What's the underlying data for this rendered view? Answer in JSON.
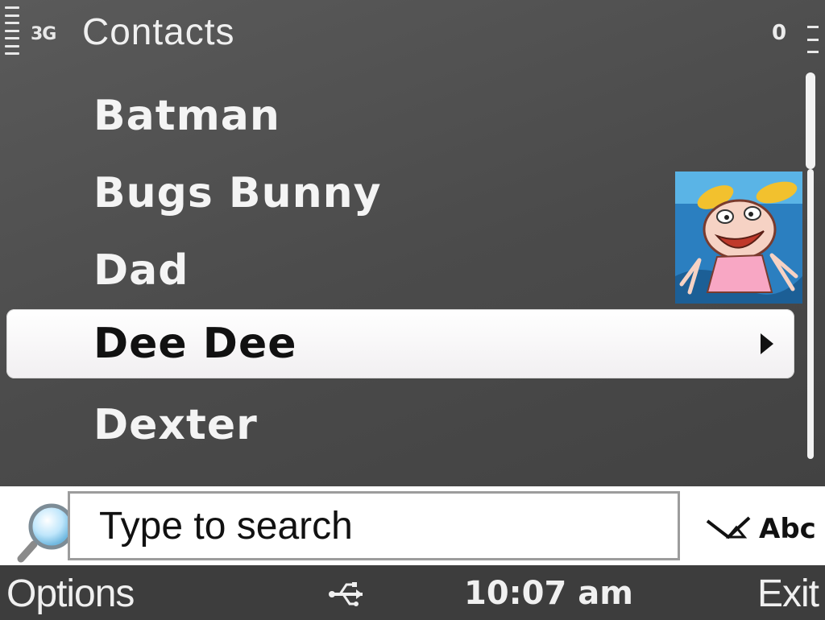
{
  "status_bar": {
    "network_type": "3G",
    "title": "Contacts",
    "indicator_count": "0",
    "signal_icon": "signal-strength-icon",
    "battery_icon": "battery-level-icon"
  },
  "contacts": [
    {
      "name": "Batman",
      "selected": false
    },
    {
      "name": "Bugs Bunny",
      "selected": false
    },
    {
      "name": "Dad",
      "selected": false
    },
    {
      "name": "Dee Dee",
      "selected": true
    },
    {
      "name": "Dexter",
      "selected": false
    }
  ],
  "selected_item_icon": "submenu-arrow-icon",
  "thumbnail_icon": "contact-photo",
  "scroll_position": 0.0,
  "search": {
    "placeholder": "Type to search",
    "icon": "magnifier-search-icon",
    "input_mode_label": "Abc",
    "input_mode_icon": "predictive-input-icon"
  },
  "softkeys": {
    "left": "Options",
    "right": "Exit",
    "center_icon": "usb-connection-icon",
    "clock": "10:07 am"
  },
  "colors": {
    "background": "#4a4a4a",
    "highlight": "#ffffff",
    "text_light": "#f4f4f4",
    "text_dark": "#111111"
  }
}
